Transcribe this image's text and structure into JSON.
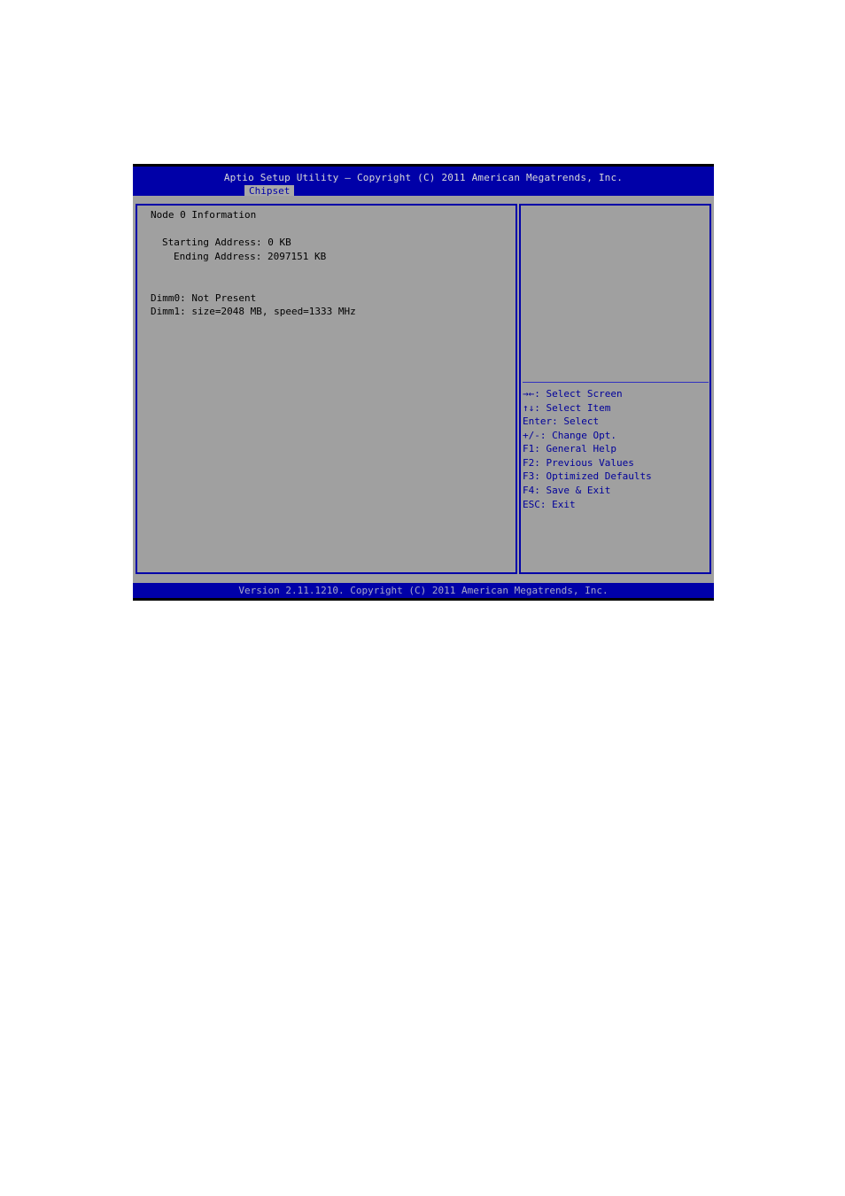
{
  "header": {
    "title": "Aptio Setup Utility – Copyright (C) 2011 American Megatrends, Inc.",
    "active_tab": "Chipset"
  },
  "main": {
    "heading": "Node 0 Information",
    "starting_address": "Starting Address: 0 KB",
    "ending_address": "Ending Address: 2097151 KB",
    "dimm0": "Dimm0: Not Present",
    "dimm1": "Dimm1: size=2048 MB, speed=1333 MHz"
  },
  "help": {
    "items": [
      "→←: Select Screen",
      "↑↓: Select Item",
      "Enter: Select",
      "+/-: Change Opt.",
      "F1: General Help",
      "F2: Previous Values",
      "F3: Optimized Defaults",
      "F4: Save & Exit",
      "ESC: Exit"
    ]
  },
  "footer": {
    "version": "Version 2.11.1210. Copyright (C) 2011 American Megatrends, Inc."
  },
  "colors": {
    "bar_blue": "#0000a8",
    "panel_gray": "#a0a0a0",
    "help_text": "#00009a"
  }
}
